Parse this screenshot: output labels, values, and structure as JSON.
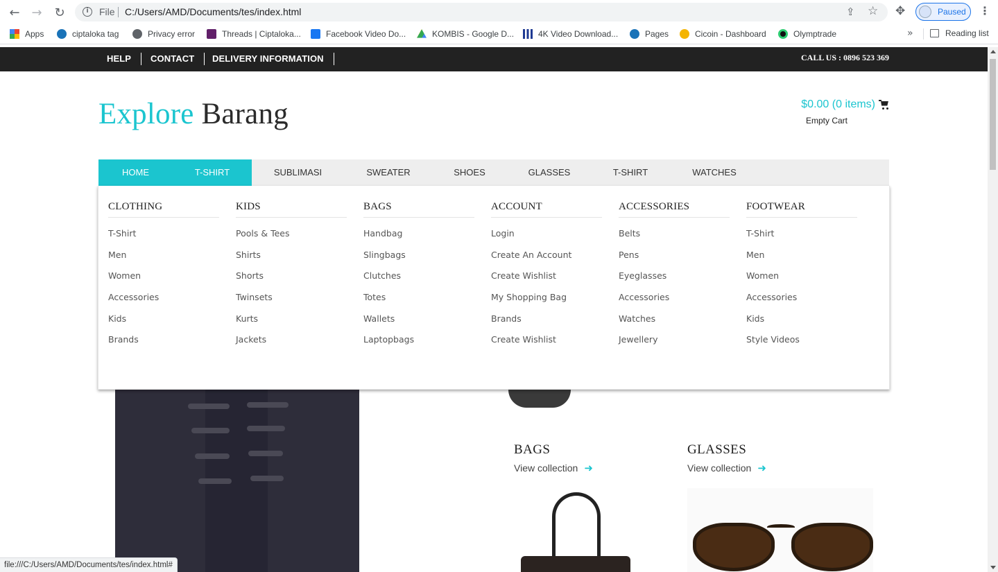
{
  "browser": {
    "scheme_label": "File",
    "url": "C:/Users/AMD/Documents/tes/index.html",
    "profile_status": "Paused",
    "bookmarks": [
      {
        "label": "Apps",
        "icon": "apps-grid-icon"
      },
      {
        "label": "ciptaloka tag",
        "icon": "ciptaloka-icon"
      },
      {
        "label": "Privacy error",
        "icon": "globe-icon"
      },
      {
        "label": "Threads | Ciptaloka...",
        "icon": "slack-icon"
      },
      {
        "label": "Facebook Video Do...",
        "icon": "fb-video-icon"
      },
      {
        "label": "KOMBIS - Google D...",
        "icon": "google-drive-icon"
      },
      {
        "label": "4K Video Download...",
        "icon": "chart-icon"
      },
      {
        "label": "Pages",
        "icon": "ciptaloka-icon"
      },
      {
        "label": "Cicoin - Dashboard",
        "icon": "cicoin-icon"
      },
      {
        "label": "Olymptrade",
        "icon": "olymptrade-icon"
      }
    ],
    "reading_list": "Reading list",
    "status_url": "file:///C:/Users/AMD/Documents/tes/index.html#"
  },
  "topbar": {
    "links": [
      "HELP",
      "CONTACT",
      "DELIVERY INFORMATION"
    ],
    "call_us": "CALL US : 0896 523 369"
  },
  "header": {
    "logo_accent": "Explore",
    "logo_rest": " Barang",
    "cart_summary": "$0.00 (0 items)",
    "cart_status": "Empty Cart"
  },
  "nav": {
    "items": [
      "HOME",
      "T-SHIRT",
      "SUBLIMASI",
      "SWEATER",
      "SHOES",
      "GLASSES",
      "T-SHIRT",
      "WATCHES"
    ]
  },
  "mega_menu": {
    "columns": [
      {
        "title": "CLOTHING",
        "items": [
          "T-Shirt",
          "Men",
          "Women",
          "Accessories",
          "Kids",
          "Brands"
        ]
      },
      {
        "title": "KIDS",
        "items": [
          "Pools & Tees",
          "Shirts",
          "Shorts",
          "Twinsets",
          "Kurts",
          "Jackets"
        ]
      },
      {
        "title": "BAGS",
        "items": [
          "Handbag",
          "Slingbags",
          "Clutches",
          "Totes",
          "Wallets",
          "Laptopbags"
        ]
      },
      {
        "title": "ACCOUNT",
        "items": [
          "Login",
          "Create An Account",
          "Create Wishlist",
          "My Shopping Bag",
          "Brands",
          "Create Wishlist"
        ]
      },
      {
        "title": "ACCESSORIES",
        "items": [
          "Belts",
          "Pens",
          "Eyeglasses",
          "Accessories",
          "Watches",
          "Jewellery"
        ]
      },
      {
        "title": "FOOTWEAR",
        "items": [
          "T-Shirt",
          "Men",
          "Women",
          "Accessories",
          "Kids",
          "Style Videos"
        ]
      }
    ]
  },
  "collections": [
    {
      "title": "BAGS",
      "link": "View collection"
    },
    {
      "title": "GLASSES",
      "link": "View collection"
    }
  ],
  "colors": {
    "accent": "#1bc5cf",
    "topbar": "#222222"
  }
}
